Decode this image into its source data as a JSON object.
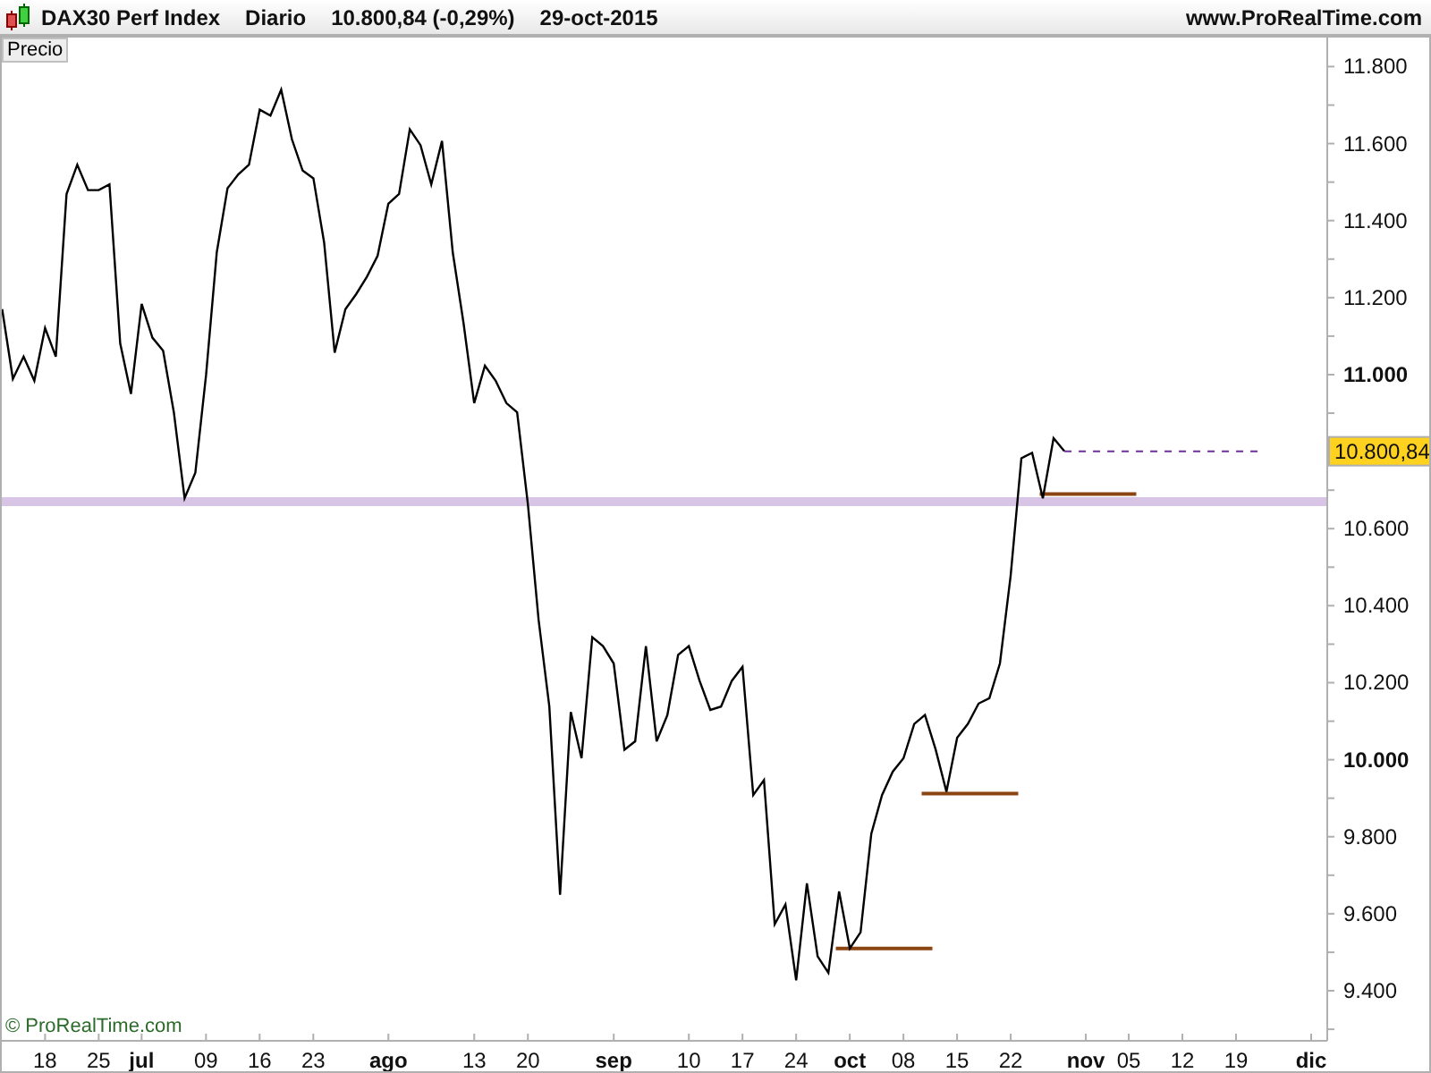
{
  "header": {
    "title": "DAX30 Perf Index",
    "period": "Diario",
    "quote": "10.800,84 (-0,29%)",
    "date": "29-oct-2015",
    "site": "www.ProRealTime.com"
  },
  "panel_label": "Precio",
  "copyright": "© ProRealTime.com",
  "price_tag": "10.800,84",
  "chart_data": {
    "type": "line",
    "ylim": [
      9270,
      11880
    ],
    "categories": [
      null,
      null,
      null,
      null,
      "18",
      null,
      null,
      null,
      null,
      "25",
      null,
      null,
      null,
      "jul",
      null,
      null,
      null,
      null,
      null,
      "09",
      null,
      null,
      null,
      null,
      "16",
      null,
      null,
      null,
      null,
      "23",
      null,
      null,
      null,
      null,
      null,
      null,
      "ago",
      null,
      null,
      null,
      null,
      null,
      null,
      null,
      "13",
      null,
      null,
      null,
      null,
      "20",
      null,
      null,
      null,
      null,
      null,
      null,
      null,
      "sep",
      null,
      null,
      null,
      null,
      null,
      null,
      "10",
      null,
      null,
      null,
      null,
      "17",
      null,
      null,
      null,
      null,
      "24",
      null,
      null,
      null,
      null,
      "oct",
      null,
      null,
      null,
      null,
      "08",
      null,
      null,
      null,
      null,
      "15",
      null,
      null,
      null,
      null,
      "22",
      null,
      null,
      null,
      null,
      null,
      null,
      "nov",
      null,
      null,
      null,
      "05",
      null,
      null,
      null,
      null,
      "12",
      null,
      null,
      null,
      null,
      "19",
      null,
      null,
      null,
      null,
      null,
      null,
      "dic",
      null
    ],
    "series": [
      {
        "color": "#000000",
        "values": [
          11170,
          10989,
          11047,
          10984,
          11121,
          11047,
          11469,
          11545,
          11479,
          11479,
          11494,
          11081,
          10950,
          11184,
          11096,
          11062,
          10902,
          10679,
          10745,
          10999,
          11318,
          11484,
          11520,
          11545,
          11688,
          11673,
          11740,
          11611,
          11530,
          11510,
          11343,
          11057,
          11170,
          11209,
          11254,
          11309,
          11444,
          11469,
          11637,
          11596,
          11494,
          11607,
          11318,
          11135,
          10926,
          11023,
          10984,
          10926,
          10902,
          10664,
          10363,
          10138,
          9649,
          10124,
          10004,
          10318,
          10295,
          10250,
          10026,
          10048,
          10295,
          10048,
          10116,
          10272,
          10295,
          10205,
          10129,
          10138,
          10205,
          10241,
          9908,
          9947,
          9573,
          9624,
          9427,
          9679,
          9489,
          9447,
          9658,
          9510,
          9552,
          9808,
          9908,
          9969,
          10004,
          10093,
          10116,
          10026,
          9917,
          10057,
          10093,
          10146,
          10160,
          10250,
          10478,
          10783,
          10797,
          10679,
          10835,
          10801,
          null,
          null,
          null,
          null,
          null,
          null,
          null,
          null,
          null,
          null,
          null,
          null,
          null,
          null,
          null,
          null,
          null,
          null,
          null,
          null,
          null,
          null,
          null,
          null
        ]
      }
    ],
    "yticks": [
      {
        "value": 9400,
        "label": "9.400"
      },
      {
        "value": 9600,
        "label": "9.600"
      },
      {
        "value": 9800,
        "label": "9.800"
      },
      {
        "value": 10000,
        "label": "10.000"
      },
      {
        "value": 10200,
        "label": "10.200"
      },
      {
        "value": 10400,
        "label": "10.400"
      },
      {
        "value": 10600,
        "label": "10.600"
      },
      {
        "value": 11000,
        "label": "11.000"
      },
      {
        "value": 11200,
        "label": "11.200"
      },
      {
        "value": 11400,
        "label": "11.400"
      },
      {
        "value": 11600,
        "label": "11.600"
      },
      {
        "value": 11800,
        "label": "11.800"
      }
    ]
  }
}
